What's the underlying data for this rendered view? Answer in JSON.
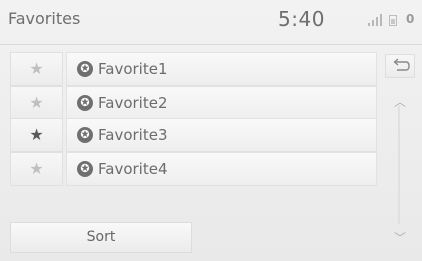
{
  "header": {
    "title": "Favorites",
    "clock": "5:40",
    "notification_count": "0"
  },
  "favorites": [
    {
      "label": "Favorite1",
      "starred": false
    },
    {
      "label": "Favorite2",
      "starred": false
    },
    {
      "label": "Favorite3",
      "starred": true
    },
    {
      "label": "Favorite4",
      "starred": false
    }
  ],
  "glyphs": {
    "star": "★",
    "back": "↩",
    "up": "︿",
    "down": "﹀",
    "fav_icon": "✪"
  },
  "footer": {
    "sort_label": "Sort"
  },
  "colors": {
    "starred": "#5a5a5a",
    "unstarred": "#c0c0c0"
  }
}
